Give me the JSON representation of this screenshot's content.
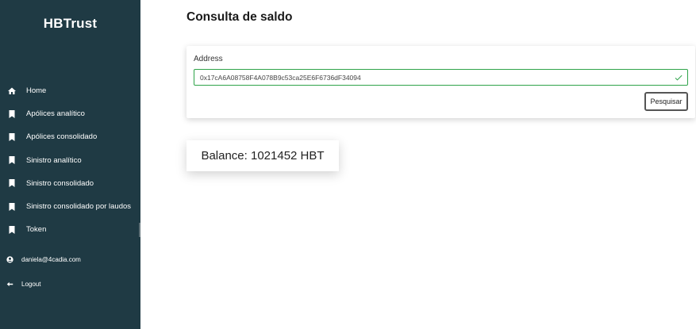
{
  "app": {
    "brand": "HBTrust"
  },
  "sidebar": {
    "items": [
      {
        "label": "Home",
        "icon": "home-icon"
      },
      {
        "label": "Apólices analítico",
        "icon": "bookmark-icon"
      },
      {
        "label": "Apólices consolidado",
        "icon": "bookmark-icon"
      },
      {
        "label": "Sinistro analítico",
        "icon": "bookmark-icon"
      },
      {
        "label": "Sinistro consolidado",
        "icon": "bookmark-icon"
      },
      {
        "label": "Sinistro consolidado por laudos",
        "icon": "bookmark-icon"
      },
      {
        "label": "Token",
        "icon": "bookmark-icon"
      }
    ],
    "user_email": "daniela@4cadia.com",
    "logout_label": "Logout"
  },
  "main": {
    "title": "Consulta de saldo",
    "address": {
      "label": "Address",
      "value": "0x17cA6A08758F4A078B9c53ca25E6F6736dF34094"
    },
    "search_button": "Pesquisar",
    "balance_text": "Balance: 1021452 HBT"
  },
  "colors": {
    "sidebar_bg": "#1f3a44",
    "valid_green": "#2fa34a"
  }
}
